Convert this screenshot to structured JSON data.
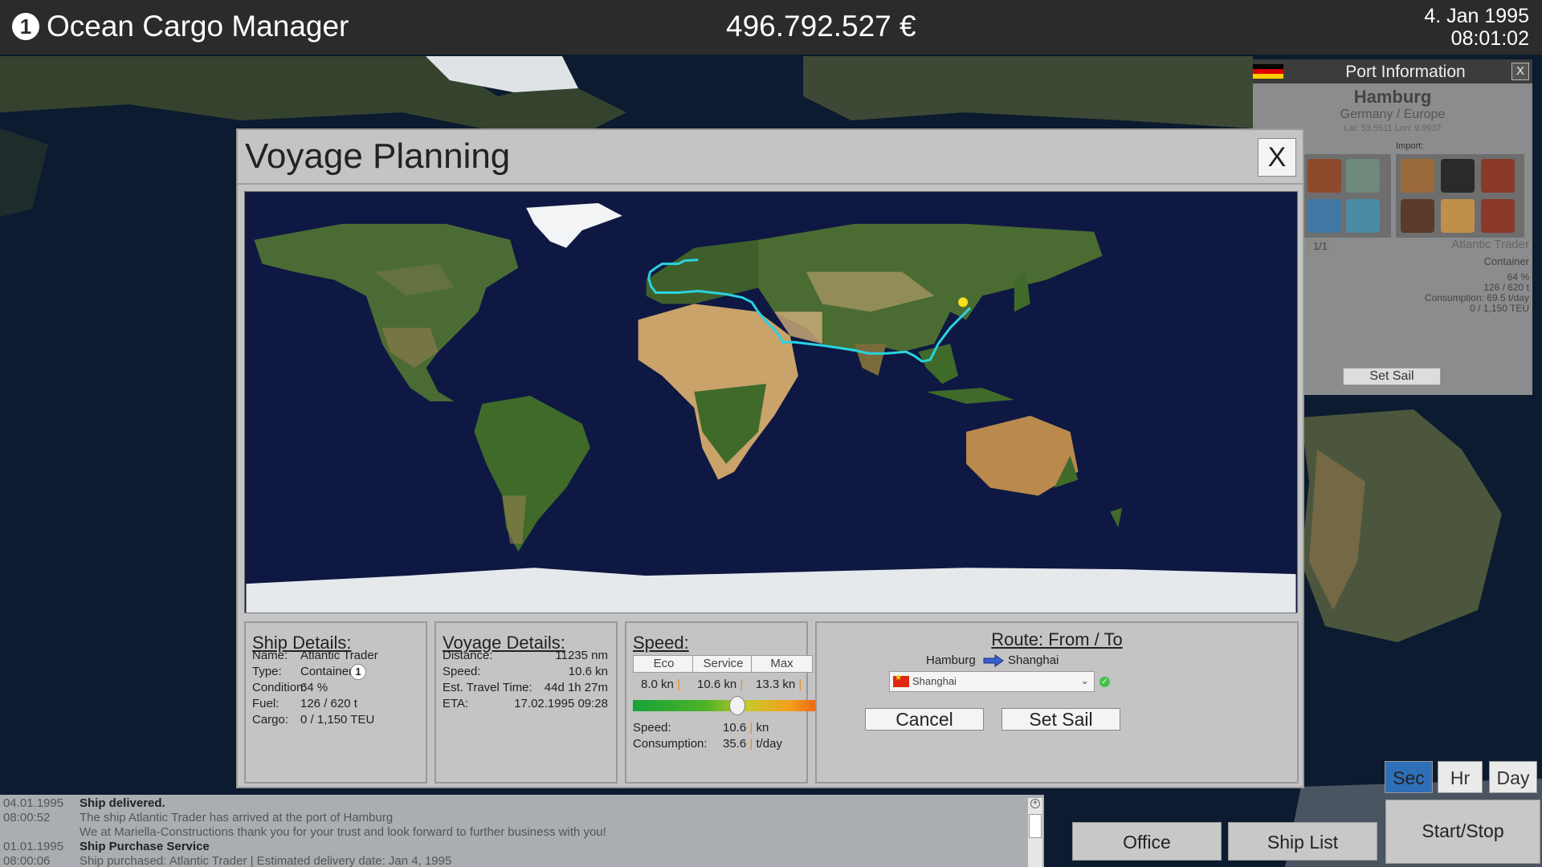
{
  "topbar": {
    "player_number": "1",
    "title": "Ocean Cargo Manager",
    "money": "496.792.527 €",
    "date": "4. Jan 1995",
    "time": "08:01:02"
  },
  "port_info": {
    "title": "Port Information",
    "close_label": "X",
    "port_name": "Hamburg",
    "country_region": "Germany / Europe",
    "coordinates": "Lat: 53.5511 Lon: 9.9937",
    "import_label": "Import:",
    "page": "1/1",
    "ship_name": "Atlantic Trader",
    "ship_type": "Container",
    "condition": "64 %",
    "fuel": "126 / 620 t",
    "consumption": "Consumption: 69.5 t/day",
    "cargo": "0 / 1,150 TEU",
    "set_sail_label": "Set Sail"
  },
  "dialog": {
    "title": "Voyage Planning",
    "close_label": "X",
    "ship_details": {
      "heading": "Ship Details:",
      "name_label": "Name:",
      "name_value": "Atlantic Trader",
      "type_label": "Type:",
      "type_value": "Container",
      "type_badge": "1",
      "condition_label": "Condition:",
      "condition_value": "64 %",
      "fuel_label": "Fuel:",
      "fuel_value": "126 / 620 t",
      "cargo_label": "Cargo:",
      "cargo_value": "0 / 1,150 TEU"
    },
    "voyage_details": {
      "heading": "Voyage Details:",
      "distance_label": "Distance:",
      "distance_value": "11235 nm",
      "speed_label": "Speed:",
      "speed_value": "10.6 kn",
      "travel_label": "Est. Travel Time:",
      "travel_value": "44d 1h 27m",
      "eta_label": "ETA:",
      "eta_value": "17.02.1995 09:28"
    },
    "speed": {
      "heading": "Speed:",
      "eco_label": "Eco",
      "eco_value": "8.0 kn",
      "service_label": "Service",
      "service_value": "10.6 kn",
      "max_label": "Max",
      "max_value": "13.3 kn",
      "slider_level": 0.5,
      "speed_label": "Speed:",
      "speed_value": "10.6",
      "speed_unit": "kn",
      "consumption_label": "Consumption:",
      "consumption_value": "35.6",
      "consumption_unit": "t/day"
    },
    "route": {
      "heading": "Route: From / To",
      "from": "Hamburg",
      "to": "Shanghai",
      "destination_selected": "Shanghai",
      "cancel_label": "Cancel",
      "set_sail_label": "Set Sail"
    }
  },
  "log": [
    {
      "date": "04.01.1995",
      "time": "08:00:52",
      "title": "Ship delivered.",
      "lines": [
        "The ship Atlantic Trader has arrived at the port of Hamburg",
        "We at Mariella-Constructions thank you for your trust and look forward to further business with you!"
      ]
    },
    {
      "date": "01.01.1995",
      "time": "08:00:06",
      "title": "Ship Purchase Service",
      "lines": [
        "Ship purchased: Atlantic Trader | Estimated delivery date: Jan 4, 1995"
      ]
    }
  ],
  "controls": {
    "sec_label": "Sec",
    "hr_label": "Hr",
    "day_label": "Day",
    "office_label": "Office",
    "shiplist_label": "Ship List",
    "startstop_label": "Start/Stop"
  },
  "colors": {
    "route_line": "#29d3e0",
    "destination_marker": "#f5e11c",
    "active_time_button": "#2f6fb8"
  }
}
